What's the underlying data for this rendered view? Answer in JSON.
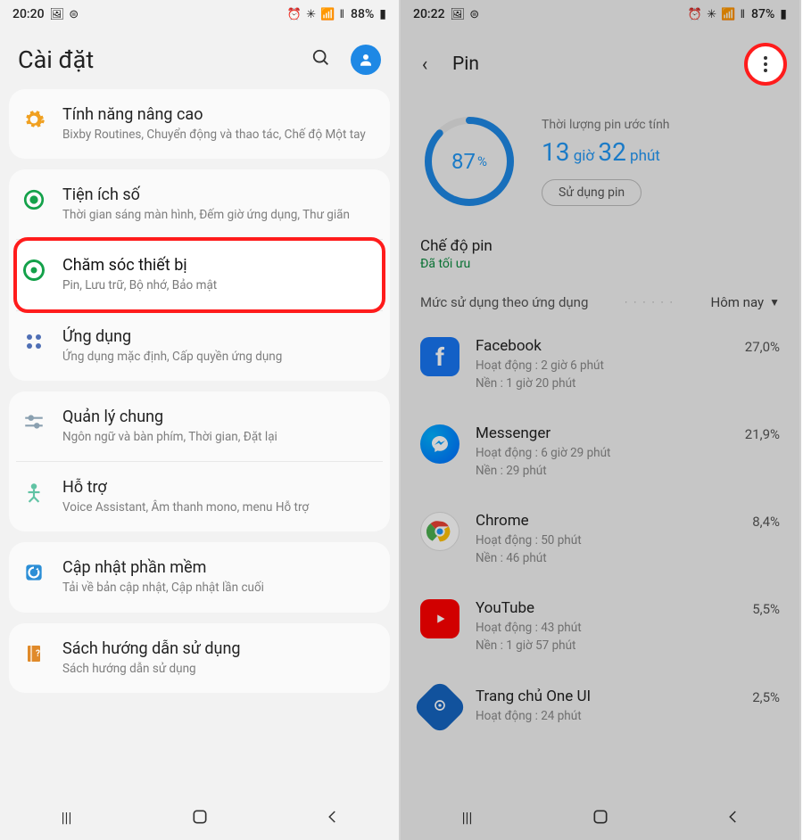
{
  "left": {
    "status": {
      "time": "20:20",
      "battery": "88%"
    },
    "title": "Cài đặt",
    "groups": [
      {
        "items": [
          {
            "icon": "cog",
            "color": "#f0a020",
            "title": "Tính năng nâng cao",
            "sub": "Bixby Routines, Chuyển động và thao tác, Chế độ Một tay"
          }
        ]
      },
      {
        "items": [
          {
            "icon": "ring-dot",
            "color": "#14a14a",
            "title": "Tiện ích số",
            "sub": "Thời gian sáng màn hình, Đếm giờ ứng dụng, Thư giãn"
          },
          {
            "icon": "swirl",
            "color": "#14a14a",
            "title": "Chăm sóc thiết bị",
            "sub": "Pin, Lưu trữ, Bộ nhớ, Bảo mật",
            "highlight": true
          },
          {
            "icon": "grid",
            "color": "#4f6fb5",
            "title": "Ứng dụng",
            "sub": "Ứng dụng mặc định, Cấp quyền ứng dụng"
          }
        ]
      },
      {
        "items": [
          {
            "icon": "sliders",
            "color": "#8aa0b0",
            "title": "Quản lý chung",
            "sub": "Ngôn ngữ và bàn phím, Thời gian, Đặt lại"
          },
          {
            "icon": "person",
            "color": "#60c3a4",
            "title": "Hỗ trợ",
            "sub": "Voice Assistant, Âm thanh mono, menu Hỗ trợ"
          }
        ]
      },
      {
        "items": [
          {
            "icon": "refresh",
            "color": "#2b8ed6",
            "title": "Cập nhật phần mềm",
            "sub": "Tải về bản cập nhật, Cập nhật lần cuối"
          }
        ]
      },
      {
        "items": [
          {
            "icon": "book",
            "color": "#e08a2a",
            "title": "Sách hướng dẫn sử dụng",
            "sub": "Sách hướng dẫn sử dụng"
          }
        ]
      }
    ]
  },
  "right": {
    "status": {
      "time": "20:22",
      "battery": "87%"
    },
    "title": "Pin",
    "ring_pct": "87",
    "ring_unit": "%",
    "est_label": "Thời lượng pin ước tính",
    "est_h": "13",
    "est_h_unit": "giờ",
    "est_m": "32",
    "est_m_unit": "phút",
    "usage_btn": "Sử dụng pin",
    "mode_title": "Chế độ pin",
    "mode_status": "Đã tối ưu",
    "usage_heading": "Mức sử dụng theo ứng dụng",
    "today": "Hôm nay",
    "apps": [
      {
        "name": "Facebook",
        "active_label": "Hoạt động",
        "active": "2 giờ 6 phút",
        "bg_label": "Nền",
        "bg": "1 giờ 20 phút",
        "pct": "27,0%",
        "ico": "fb"
      },
      {
        "name": "Messenger",
        "active_label": "Hoạt động",
        "active": "6 giờ 29 phút",
        "bg_label": "Nền",
        "bg": "29 phút",
        "pct": "21,9%",
        "ico": "msg"
      },
      {
        "name": "Chrome",
        "active_label": "Hoạt động",
        "active": "50 phút",
        "bg_label": "Nền",
        "bg": "46 phút",
        "pct": "8,4%",
        "ico": "chrome"
      },
      {
        "name": "YouTube",
        "active_label": "Hoạt động",
        "active": "43 phút",
        "bg_label": "Nền",
        "bg": "1 giờ 57 phút",
        "pct": "5,5%",
        "ico": "yt"
      },
      {
        "name": "Trang chủ One UI",
        "active_label": "Hoạt động",
        "active": "24 phút",
        "bg_label": "",
        "bg": "",
        "pct": "2,5%",
        "ico": "oneui"
      }
    ]
  }
}
